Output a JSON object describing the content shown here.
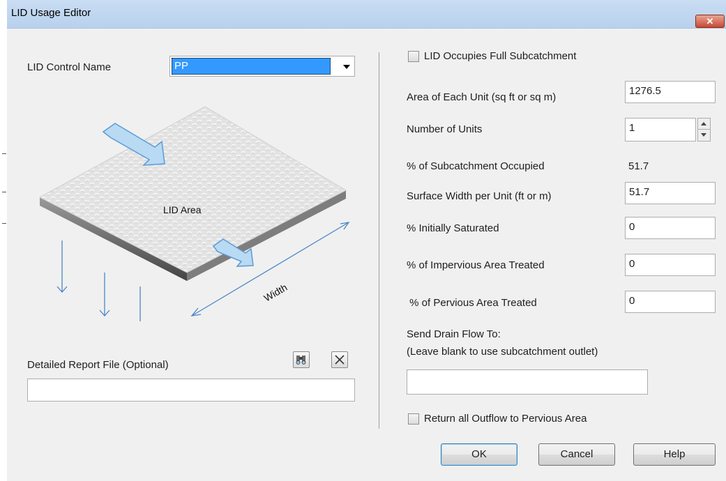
{
  "window": {
    "title": "LID Usage Editor",
    "close_glyph": "✕"
  },
  "left": {
    "control_name_label": "LID Control Name",
    "control_name_value": "PP",
    "illustration": {
      "area_label": "LID Area",
      "width_label": "Width"
    },
    "report_label": "Detailed Report File (Optional)",
    "report_value": ""
  },
  "right": {
    "full_subcatchment_label": "LID Occupies Full Subcatchment",
    "fields": {
      "area_label": "Area of Each Unit (sq ft or sq m)",
      "area_value": "1276.5",
      "units_label": "Number of Units",
      "units_value": "1",
      "occupied_label": "% of Subcatchment Occupied",
      "occupied_value": "51.7",
      "width_label": "Surface Width per Unit (ft or m)",
      "width_value": "51.7",
      "saturated_label": "% Initially Saturated",
      "saturated_value": "0",
      "impervious_label": "% of Impervious Area Treated",
      "impervious_value": "0",
      "pervious_label": " % of Pervious Area Treated",
      "pervious_value": "0"
    },
    "drain_label_1": "Send Drain Flow To:",
    "drain_label_2": "(Leave blank to use subcatchment outlet)",
    "drain_value": "",
    "return_outflow_label": "Return all Outflow to Pervious Area"
  },
  "buttons": {
    "ok": "OK",
    "cancel": "Cancel",
    "help": "Help"
  },
  "icons": {
    "browse": "binoculars-icon",
    "clear": "x-icon",
    "colors": {
      "arrow_fill": "#b9daf3",
      "arrow_stroke": "#5b9bd5",
      "line": "#4a86c8"
    }
  }
}
